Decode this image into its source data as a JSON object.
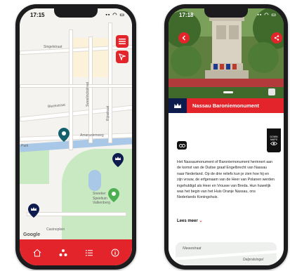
{
  "left_phone": {
    "status": {
      "time": "17:15",
      "icons": "▪▪ ◠ ▭"
    },
    "map": {
      "street_labels": [
        {
          "text": "Singelstraat"
        },
        {
          "text": "Bleekstraat"
        },
        {
          "text": "Sweelinckstraat"
        },
        {
          "text": "Rijnstraat"
        },
        {
          "text": "Amarantenweg"
        },
        {
          "text": "Park"
        },
        {
          "text": "Sneeker"
        },
        {
          "text": "Speeltuin\nValkenberg"
        },
        {
          "text": "Casinoplein"
        }
      ],
      "google_label": "Google"
    },
    "nav": {
      "items": [
        {
          "icon": "home-icon"
        },
        {
          "icon": "route-icon"
        },
        {
          "icon": "list-icon"
        },
        {
          "icon": "info-icon"
        }
      ]
    },
    "colors": {
      "accent": "#e3242b",
      "navy": "#0d1b4d"
    }
  },
  "right_phone": {
    "status": {
      "time": "17:18",
      "icons": "▪▪ ◠ ▭"
    },
    "title": "Nassau Baroniemonument",
    "badge": "DOWN\nMAPS",
    "body": "Het Nassaumonument of Baroniemonument herinnert aan de komst van de Duitse graaf Engelbrecht van Nassau naar Nederland. Op de drie reliefs kun je zien hoe hij en zijn vrouw, de erfgenaam van de Heer van Polanen werden ingehuldigd als Heer en Vrouwe van Breda. Hun huwelijk was het begin van het Huis Oranje Nassau, ons Nederlands Koningshuis.",
    "read_more": "Lees meer",
    "mini_map": {
      "label1": "Nieuwstraat",
      "label2": "Delpratsingel"
    }
  }
}
